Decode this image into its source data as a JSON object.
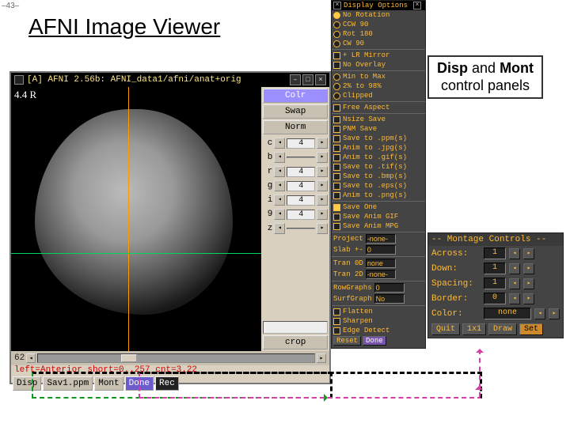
{
  "slide_number": "–43–",
  "title": "AFNI Image Viewer",
  "note_html": "Disp and Mont control panels",
  "viewer": {
    "titlebar": "[A] AFNI 2.56b: AFNI_data1/afni/anat+orig",
    "overlay_label": "4.4 R",
    "side": {
      "colr": "Colr",
      "swap": "Swap",
      "norm": "Norm",
      "rows": [
        {
          "lbl": "c",
          "val": "4"
        },
        {
          "lbl": "b",
          "val": ""
        },
        {
          "lbl": "r",
          "val": "4"
        },
        {
          "lbl": "g",
          "val": "4"
        },
        {
          "lbl": "i",
          "val": "4"
        },
        {
          "lbl": "9",
          "val": "4"
        },
        {
          "lbl": "z",
          "val": ""
        }
      ],
      "crop": "crop"
    },
    "slice": "62",
    "status": "left=Anterior short=0..257 cnt=3.22",
    "buttons": {
      "disp": "Disp",
      "sav": "Sav1.ppm",
      "mont": "Mont",
      "done": "Done",
      "rec": "Rec"
    }
  },
  "disp": {
    "title": "Display Options",
    "items": [
      {
        "lbl": "No Rotation",
        "type": "radio",
        "on": true
      },
      {
        "lbl": "CCW 90",
        "type": "radio"
      },
      {
        "lbl": "Rot 180",
        "type": "radio"
      },
      {
        "lbl": "CW 90",
        "type": "radio"
      },
      {
        "sep": true
      },
      {
        "lbl": "+ LR Mirror",
        "type": "check"
      },
      {
        "lbl": "No Overlay",
        "type": "check"
      },
      {
        "sep": true
      },
      {
        "lbl": "Min to Max",
        "type": "radio"
      },
      {
        "lbl": "2% to 98%",
        "type": "radio"
      },
      {
        "lbl": "Clipped",
        "type": "radio"
      },
      {
        "sep": true
      },
      {
        "lbl": "Free Aspect",
        "type": "check"
      },
      {
        "sep": true
      },
      {
        "lbl": "Nsize Save",
        "type": "check"
      },
      {
        "lbl": "PNM Save",
        "type": "check"
      },
      {
        "lbl": "Save to .ppm(s)",
        "type": "check"
      },
      {
        "lbl": "Anim to .jpg(s)",
        "type": "check"
      },
      {
        "lbl": "Anim to .gif(s)",
        "type": "check"
      },
      {
        "lbl": "Save to .tif(s)",
        "type": "check"
      },
      {
        "lbl": "Save to .bmp(s)",
        "type": "check"
      },
      {
        "lbl": "Save to .eps(s)",
        "type": "check"
      },
      {
        "lbl": "Anim to .png(s)",
        "type": "check"
      },
      {
        "sep": true
      },
      {
        "lbl": "Save One",
        "type": "check",
        "on": true
      },
      {
        "lbl": "Save Anim GIF",
        "type": "check"
      },
      {
        "lbl": "Save Anim MPG",
        "type": "check"
      },
      {
        "sep": true
      },
      {
        "lbl": "Project",
        "type": "input",
        "val": "-none-"
      },
      {
        "lbl": "Slab +-",
        "type": "input",
        "val": "0"
      },
      {
        "sep": true
      },
      {
        "lbl": "Tran 0D",
        "type": "input",
        "val": "none"
      },
      {
        "lbl": "Tran 2D",
        "type": "input",
        "val": "-none-"
      },
      {
        "sep": true
      },
      {
        "lbl": "RowGraphs",
        "type": "input",
        "val": "0"
      },
      {
        "lbl": "SurfGraph",
        "type": "input",
        "val": "No"
      },
      {
        "sep": true
      },
      {
        "lbl": "Flatten",
        "type": "check"
      },
      {
        "lbl": "Sharpen",
        "type": "check"
      },
      {
        "lbl": "Edge Detect",
        "type": "check"
      }
    ],
    "reset": "Reset",
    "done": "Done"
  },
  "mont": {
    "header": "-- Montage Controls --",
    "rows": [
      {
        "lbl": "Across:",
        "val": "1"
      },
      {
        "lbl": "Down:",
        "val": "1"
      },
      {
        "lbl": "Spacing:",
        "val": "1"
      },
      {
        "lbl": "Border:",
        "val": "0"
      },
      {
        "lbl": "Color:",
        "val": "none",
        "wide": true
      }
    ],
    "quit": "Quit",
    "one": "1x1",
    "draw": "Draw",
    "set": "Set"
  }
}
